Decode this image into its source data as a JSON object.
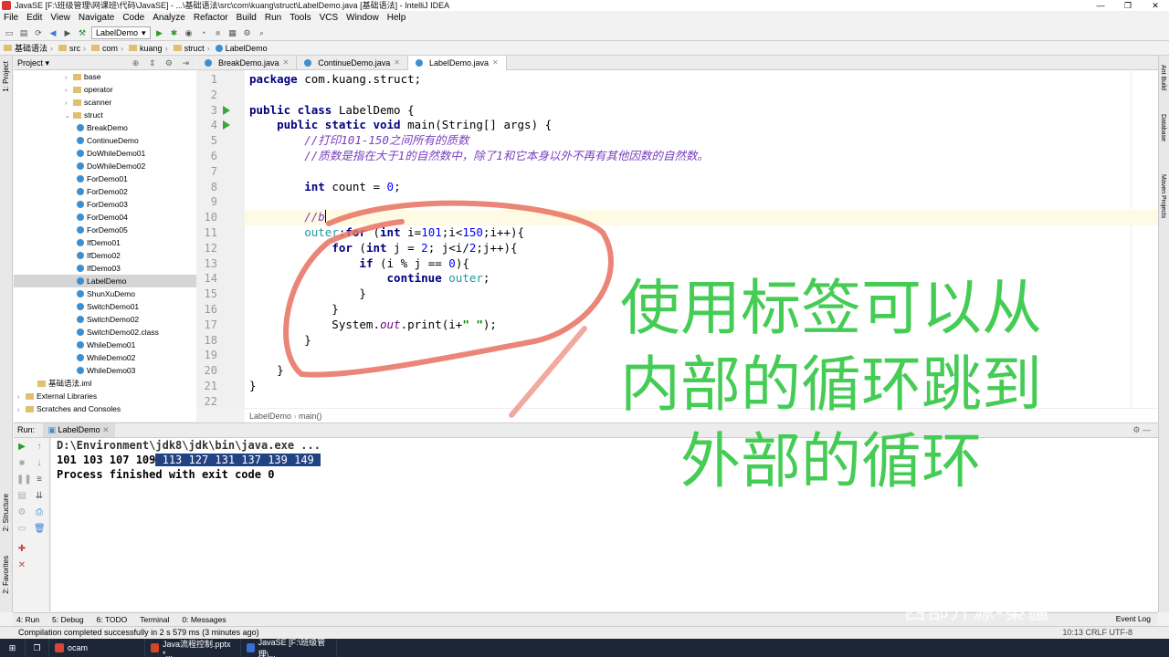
{
  "window": {
    "title": "JavaSE [F:\\班级管理\\网课班\\代码\\JavaSE] - ...\\基础语法\\src\\com\\kuang\\struct\\LabelDemo.java [基础语法] - IntelliJ IDEA"
  },
  "menu": [
    "File",
    "Edit",
    "View",
    "Navigate",
    "Code",
    "Analyze",
    "Refactor",
    "Build",
    "Run",
    "Tools",
    "VCS",
    "Window",
    "Help"
  ],
  "toolbar": {
    "run_config": "LabelDemo"
  },
  "breadcrumb": [
    "基础语法",
    "src",
    "com",
    "kuang",
    "struct",
    "LabelDemo"
  ],
  "project": {
    "header": "Project",
    "tree": [
      {
        "label": "base",
        "type": "folder",
        "indent": 4,
        "arrow": "›"
      },
      {
        "label": "operator",
        "type": "folder",
        "indent": 4,
        "arrow": "›"
      },
      {
        "label": "scanner",
        "type": "folder",
        "indent": 4,
        "arrow": "›"
      },
      {
        "label": "struct",
        "type": "folder",
        "indent": 4,
        "arrow": "⌄"
      },
      {
        "label": "BreakDemo",
        "type": "class",
        "indent": 5
      },
      {
        "label": "ContinueDemo",
        "type": "class",
        "indent": 5
      },
      {
        "label": "DoWhileDemo01",
        "type": "class",
        "indent": 5
      },
      {
        "label": "DoWhileDemo02",
        "type": "class",
        "indent": 5
      },
      {
        "label": "ForDemo01",
        "type": "class",
        "indent": 5
      },
      {
        "label": "ForDemo02",
        "type": "class",
        "indent": 5
      },
      {
        "label": "ForDemo03",
        "type": "class",
        "indent": 5
      },
      {
        "label": "ForDemo04",
        "type": "class",
        "indent": 5
      },
      {
        "label": "ForDemo05",
        "type": "class",
        "indent": 5
      },
      {
        "label": "IfDemo01",
        "type": "class",
        "indent": 5
      },
      {
        "label": "IfDemo02",
        "type": "class",
        "indent": 5
      },
      {
        "label": "IfDemo03",
        "type": "class",
        "indent": 5
      },
      {
        "label": "LabelDemo",
        "type": "class",
        "indent": 5,
        "selected": true
      },
      {
        "label": "ShunXuDemo",
        "type": "class",
        "indent": 5
      },
      {
        "label": "SwitchDemo01",
        "type": "class",
        "indent": 5
      },
      {
        "label": "SwitchDemo02",
        "type": "class",
        "indent": 5
      },
      {
        "label": "SwitchDemo02.class",
        "type": "class",
        "indent": 5
      },
      {
        "label": "WhileDemo01",
        "type": "class",
        "indent": 5
      },
      {
        "label": "WhileDemo02",
        "type": "class",
        "indent": 5
      },
      {
        "label": "WhileDemo03",
        "type": "class",
        "indent": 5
      },
      {
        "label": "基础语法.iml",
        "type": "file",
        "indent": 1
      },
      {
        "label": "External Libraries",
        "type": "folder",
        "indent": 0,
        "arrow": "›"
      },
      {
        "label": "Scratches and Consoles",
        "type": "folder",
        "indent": 0,
        "arrow": "›"
      }
    ]
  },
  "tabs": [
    {
      "label": "BreakDemo.java",
      "active": false
    },
    {
      "label": "ContinueDemo.java",
      "active": false
    },
    {
      "label": "LabelDemo.java",
      "active": true
    }
  ],
  "code": [
    {
      "n": "1",
      "html": "<span class=\"kw\">package</span> com.kuang.struct;"
    },
    {
      "n": "2",
      "html": ""
    },
    {
      "n": "3",
      "html": "<span class=\"kw\">public class</span> LabelDemo {",
      "run": true
    },
    {
      "n": "4",
      "html": "    <span class=\"kw\">public static void</span> main(String[] args) {",
      "run": true
    },
    {
      "n": "5",
      "html": "        <span class=\"cm\">//打印101-150之间所有的质数</span>"
    },
    {
      "n": "6",
      "html": "        <span class=\"cm\">//质数是指在大于1的自然数中，除了1和它本身以外不再有其他因数的自然数。</span>"
    },
    {
      "n": "7",
      "html": ""
    },
    {
      "n": "8",
      "html": "        <span class=\"kw\">int</span> count = <span class=\"num\">0</span>;"
    },
    {
      "n": "9",
      "html": ""
    },
    {
      "n": "10",
      "html": "        <span class=\"cm\">//b</span>",
      "current": true
    },
    {
      "n": "11",
      "html": "        <span class=\"lbl\">outer</span>:<span class=\"kw\">for</span> (<span class=\"kw\">int</span> i=<span class=\"num\">101</span>;i&lt;<span class=\"num\">150</span>;i++){"
    },
    {
      "n": "12",
      "html": "            <span class=\"kw\">for</span> (<span class=\"kw\">int</span> j = <span class=\"num\">2</span>; j&lt;i/<span class=\"num\">2</span>;j++){"
    },
    {
      "n": "13",
      "html": "                <span class=\"kw\">if</span> (i % j == <span class=\"num\">0</span>){"
    },
    {
      "n": "14",
      "html": "                    <span class=\"kw\">continue</span> <span class=\"lbl\">outer</span>;"
    },
    {
      "n": "15",
      "html": "                }"
    },
    {
      "n": "16",
      "html": "            }"
    },
    {
      "n": "17",
      "html": "            System.<span class=\"it\">out</span>.print(i+<span style=\"color:#008000;font-weight:bold\">\" \"</span>);"
    },
    {
      "n": "18",
      "html": "        }"
    },
    {
      "n": "19",
      "html": ""
    },
    {
      "n": "20",
      "html": "    }"
    },
    {
      "n": "21",
      "html": "}"
    },
    {
      "n": "22",
      "html": ""
    }
  ],
  "editor_crumb": [
    "LabelDemo",
    "main()"
  ],
  "run": {
    "header": "Run:",
    "tab": "LabelDemo",
    "lines": [
      "D:\\Environment\\jdk8\\jdk\\bin\\java.exe ...",
      "101 103 107 109",
      "Process finished with exit code 0"
    ],
    "selected_output": " 113 127 131 137 139 149 "
  },
  "bottom_tabs": [
    "4: Run",
    "5: Debug",
    "6: TODO",
    "Terminal",
    "0: Messages"
  ],
  "event_log": "Event Log",
  "status": {
    "message": "Compilation completed successfully in 2 s 579 ms (3 minutes ago)",
    "right": "10:13  CRLF  UTF-8"
  },
  "side_left": [
    "1: Project",
    "2: Structure",
    "2: Favorites"
  ],
  "side_right": [
    "Ant Build",
    "Database",
    "Maven Projects"
  ],
  "taskbar": [
    {
      "label": "ocam",
      "color": "#d9443b"
    },
    {
      "label": "Java流程控制.pptx *...",
      "color": "#d24726"
    },
    {
      "label": "JavaSE [F:\\班级管理\\...",
      "color": "#3b6fd0"
    }
  ],
  "overlay": {
    "lines": [
      "使用标签可以从",
      "内部的循环跳到",
      "外部的循环"
    ],
    "color": "#45cc55"
  },
  "watermark": "西部开源-秦疆"
}
